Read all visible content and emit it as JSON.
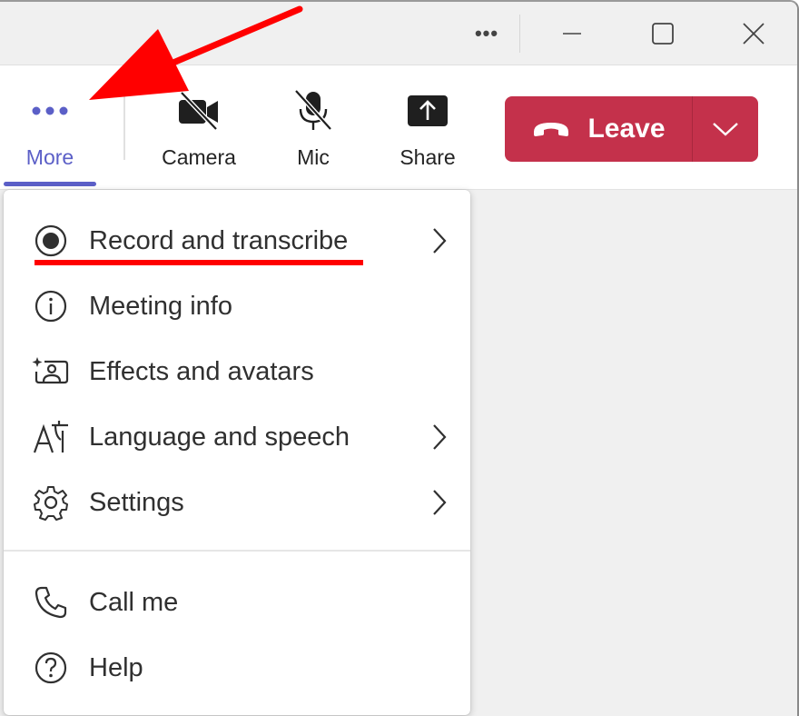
{
  "titlebar": {
    "more_label": "•••",
    "icons": [
      "more-horizontal-icon",
      "minimize-icon",
      "maximize-icon",
      "close-icon"
    ]
  },
  "toolbar": {
    "more_label": "More",
    "camera_label": "Camera",
    "mic_label": "Mic",
    "share_label": "Share",
    "leave_label": "Leave",
    "accent_color": "#5b5fc7",
    "leave_color": "#c4314b"
  },
  "menu": {
    "items": [
      {
        "label": "Record and transcribe",
        "icon": "record-icon",
        "submenu": true
      },
      {
        "label": "Meeting info",
        "icon": "info-icon",
        "submenu": false
      },
      {
        "label": "Effects and avatars",
        "icon": "effects-icon",
        "submenu": false
      },
      {
        "label": "Language and speech",
        "icon": "language-icon",
        "submenu": true
      },
      {
        "label": "Settings",
        "icon": "gear-icon",
        "submenu": true
      },
      {
        "label": "Call me",
        "icon": "phone-icon",
        "submenu": false
      },
      {
        "label": "Help",
        "icon": "help-icon",
        "submenu": false
      }
    ]
  },
  "annotations": {
    "arrow_color": "#ff0000",
    "underline_color": "#ff0000"
  }
}
